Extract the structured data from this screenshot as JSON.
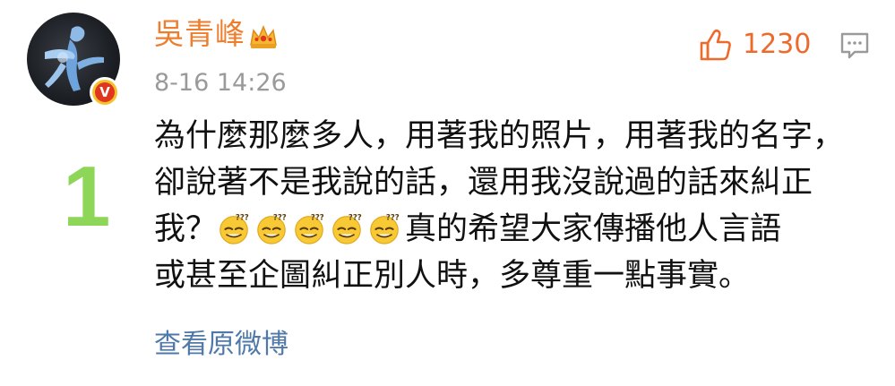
{
  "post": {
    "username": "吳青峰",
    "timestamp": "8-16 14:26",
    "like_count": "1230",
    "list_number": "1",
    "view_original_label": "查看原微博",
    "body_lines": [
      "為什麼那麼多人，用著我的照片，用著我的名字，",
      "卻說著不是我說的話，還用我沒說過的話來糾正",
      "我？",
      "真的希望大家傳播他人言語",
      "或甚至企圖糾正別人時，多尊重一點事實。"
    ],
    "verified_badge": "V",
    "emoji_name": "thinking-face-emoji",
    "emoji_count": 5
  },
  "colors": {
    "username": "#ee7e2d",
    "like": "#ee6a2a",
    "link": "#4f79a8",
    "number": "#8ed657",
    "timestamp": "#9a9a9a"
  },
  "icons": {
    "crown": "crown-icon",
    "like": "thumbs-up-icon",
    "comment": "comment-icon"
  }
}
